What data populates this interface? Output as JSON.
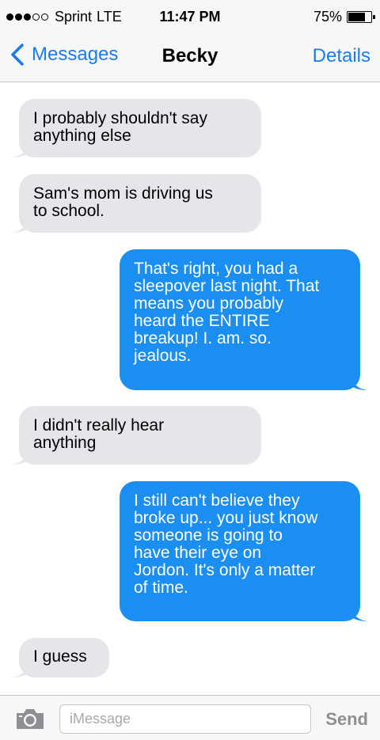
{
  "status_bar": {
    "signal_dots_filled": 3,
    "signal_dots_total": 5,
    "carrier": "Sprint",
    "network": "LTE",
    "time": "11:47 PM",
    "battery_percent": "75%",
    "battery_level": 0.75
  },
  "nav": {
    "back_label": "Messages",
    "title": "Becky",
    "details_label": "Details"
  },
  "messages": [
    {
      "direction": "incoming",
      "lines": [
        "I probably shouldn't say",
        "anything else"
      ]
    },
    {
      "direction": "incoming",
      "lines": [
        "Sam's mom is driving us",
        "to school."
      ]
    },
    {
      "direction": "outgoing",
      "lines": [
        "That's right, you had a",
        "sleepover last night. That",
        "means you probably",
        "heard the ENTIRE",
        "breakup! I. am. so.",
        "jealous."
      ]
    },
    {
      "direction": "incoming",
      "lines": [
        "I didn't really hear",
        "anything"
      ]
    },
    {
      "direction": "outgoing",
      "lines": [
        "I still can't believe they",
        "broke up... you just know",
        "someone is going to",
        "have their eye on",
        "Jordon. It's only a matter",
        "of time."
      ]
    },
    {
      "direction": "incoming",
      "lines": [
        "I guess"
      ]
    }
  ],
  "input_bar": {
    "placeholder": "iMessage",
    "value": "",
    "send_label": "Send"
  },
  "colors": {
    "accent": "#1a7cf5",
    "outgoing_bubble": "#1b8ef2",
    "incoming_bubble": "#e5e5ea",
    "bar_background": "#f7f7f7"
  },
  "icons": [
    "back-chevron-icon",
    "camera-icon",
    "battery-icon",
    "signal-dots-icon"
  ]
}
